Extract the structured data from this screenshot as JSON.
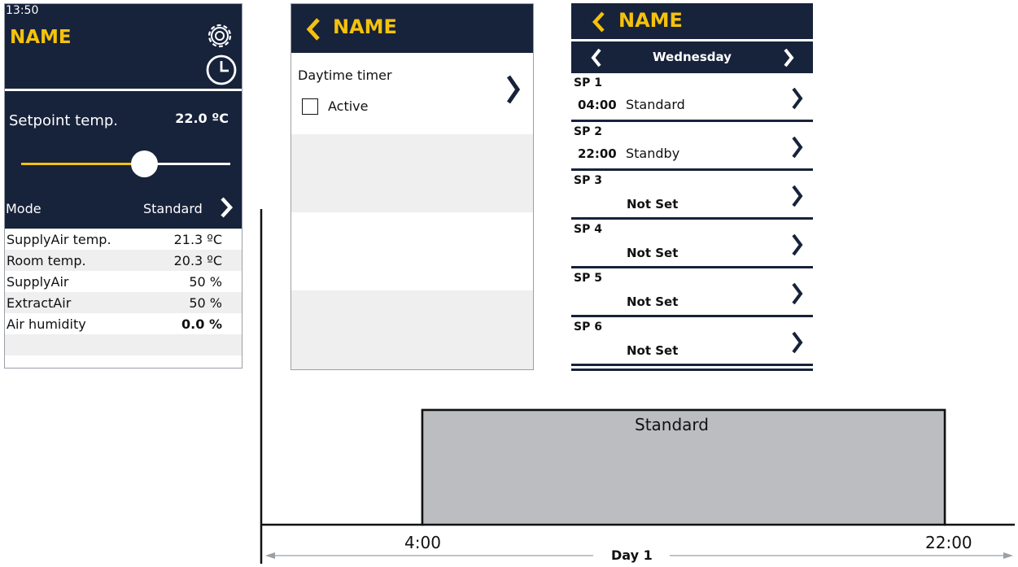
{
  "screen1": {
    "time": "13:50",
    "title": "NAME",
    "setpoint_label": "Setpoint temp.",
    "setpoint_value": "22.0 ºC",
    "slider_fraction": 0.58,
    "mode_label": "Mode",
    "mode_value": "Standard",
    "rows": [
      {
        "label": "SupplyAir temp.",
        "value": "21.3 ºC"
      },
      {
        "label": "Room temp.",
        "value": "20.3 ºC"
      },
      {
        "label": "SupplyAir",
        "value": "50 %"
      },
      {
        "label": "ExtractAir",
        "value": "50 %"
      },
      {
        "label": "Air humidity",
        "value": "0.0 %"
      }
    ],
    "icons": [
      "gear-icon",
      "clock-icon",
      "chevron-right-icon"
    ]
  },
  "screen2": {
    "title": "NAME",
    "item_label": "Daytime timer",
    "checkbox_label": "Active",
    "checkbox_checked": false,
    "icons": [
      "chevron-left-icon",
      "chevron-right-icon"
    ]
  },
  "screen3": {
    "title": "NAME",
    "day": "Wednesday",
    "items": [
      {
        "name": "SP 1",
        "time": "04:00",
        "mode": "Standard",
        "not_set": ""
      },
      {
        "name": "SP 2",
        "time": "22:00",
        "mode": "Standby",
        "not_set": ""
      },
      {
        "name": "SP 3",
        "time": "",
        "mode": "",
        "not_set": "Not Set"
      },
      {
        "name": "SP 4",
        "time": "",
        "mode": "",
        "not_set": "Not Set"
      },
      {
        "name": "SP 5",
        "time": "",
        "mode": "",
        "not_set": "Not Set"
      },
      {
        "name": "SP 6",
        "time": "",
        "mode": "",
        "not_set": "Not Set"
      }
    ]
  },
  "timeline": {
    "block_label": "Standard",
    "start_label": "4:00",
    "end_label": "22:00",
    "day_label": "Day 1"
  },
  "colors": {
    "navy": "#17223b",
    "accent": "#f4c20d",
    "row_alt": "#efefef",
    "block": "#bcbdc0"
  }
}
